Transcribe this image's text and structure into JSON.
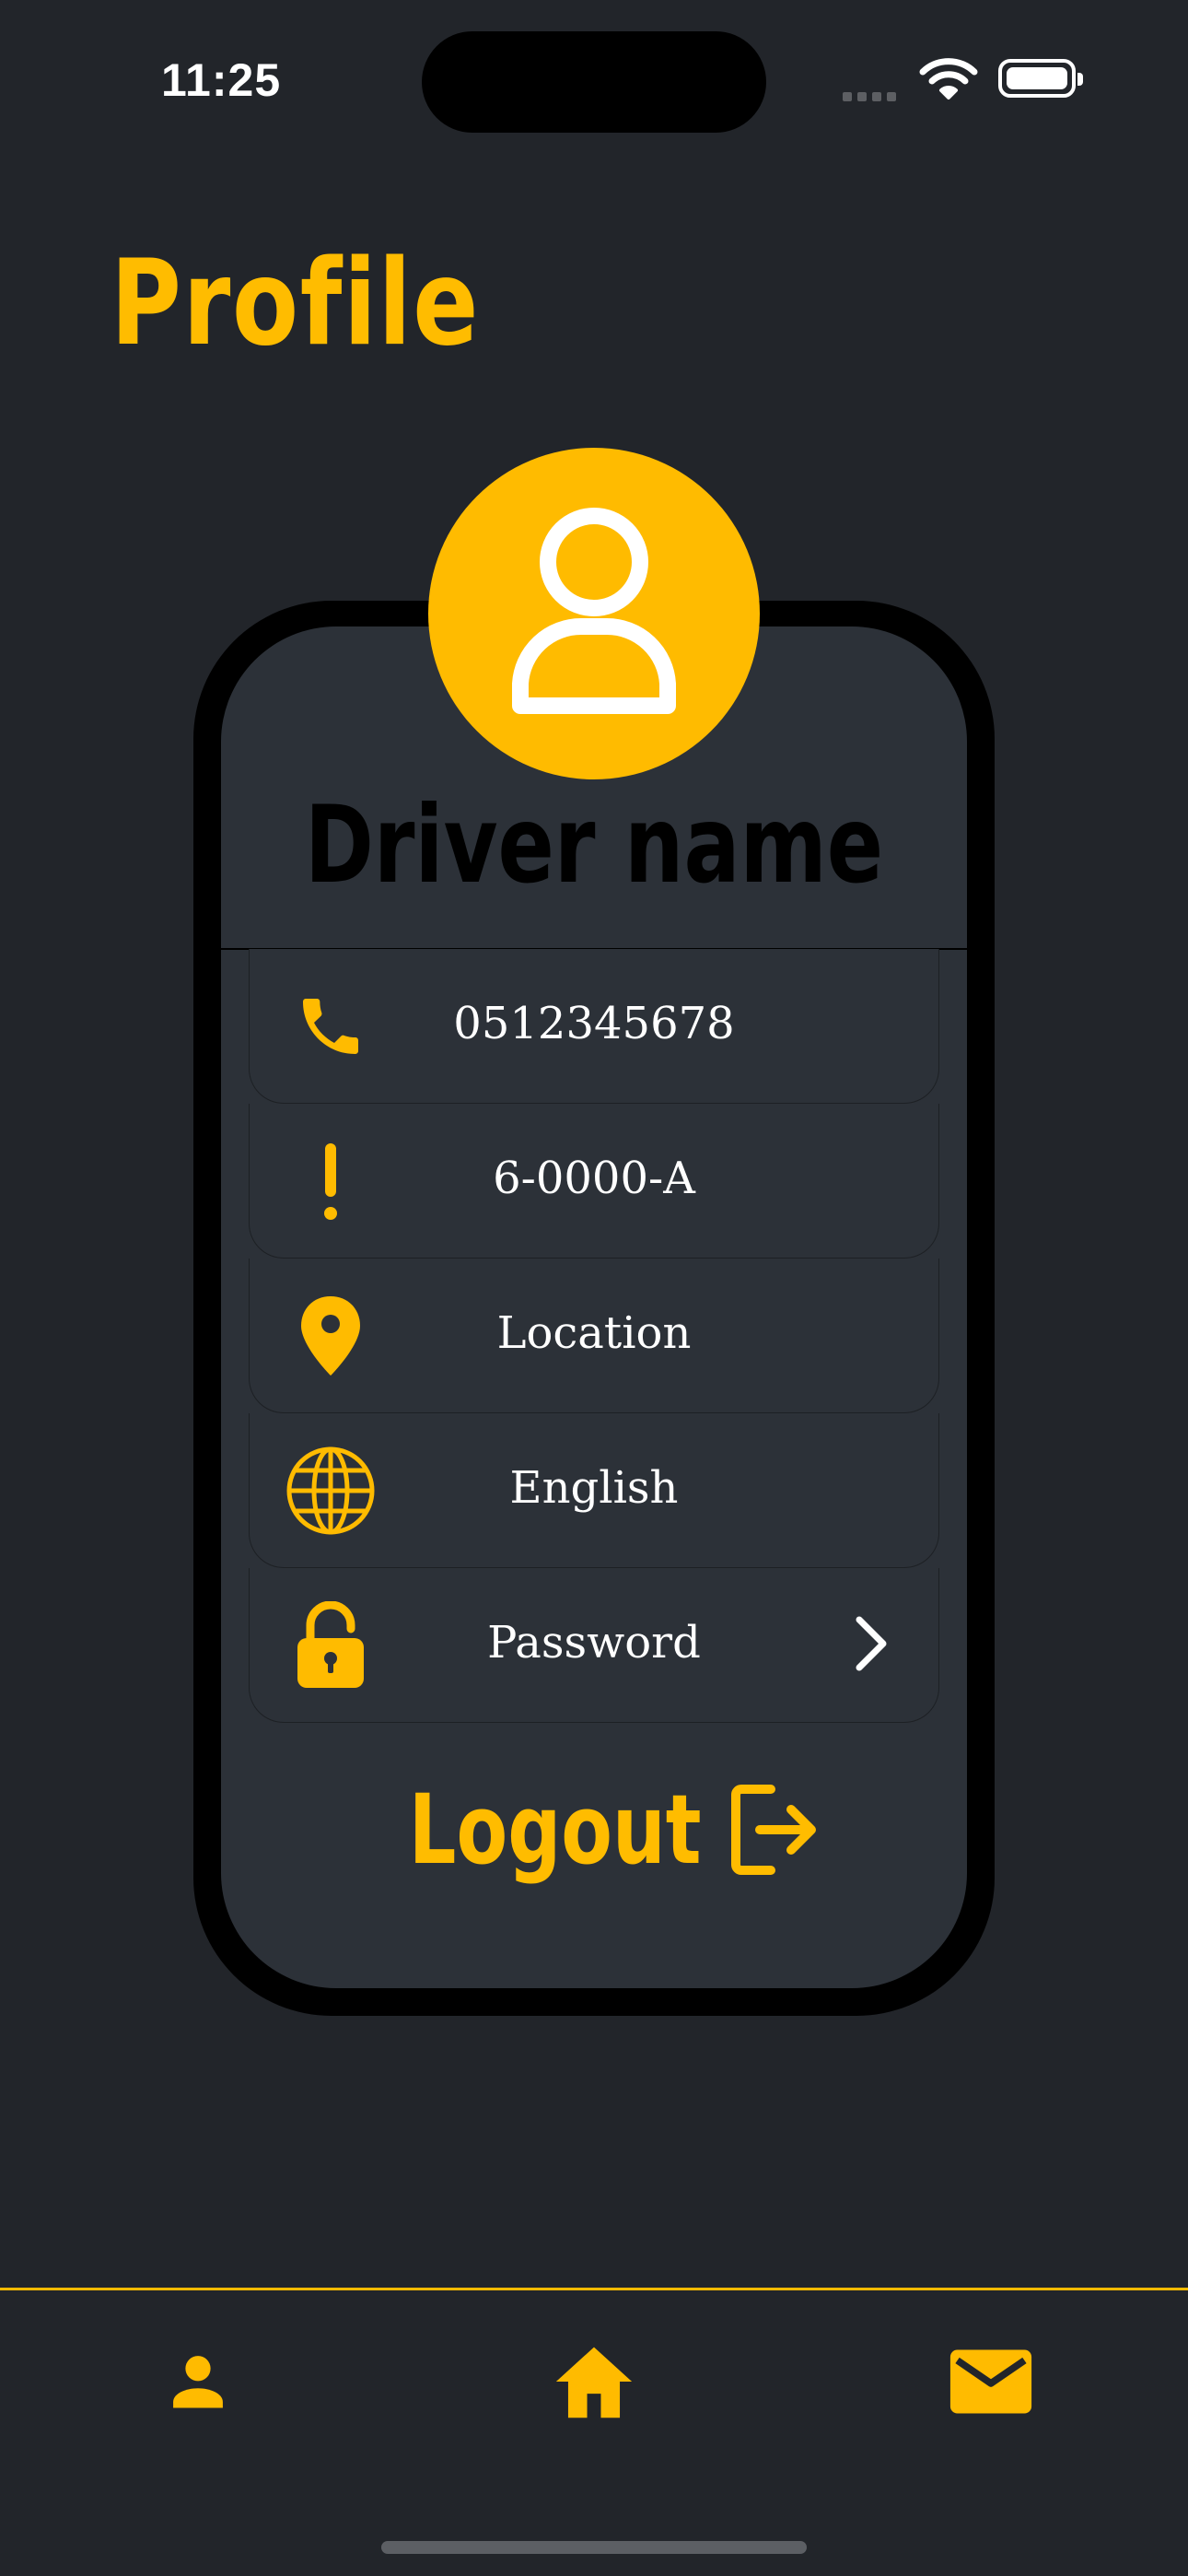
{
  "status_bar": {
    "time": "11:25"
  },
  "page": {
    "title": "Profile"
  },
  "profile": {
    "name": "Driver name",
    "avatar_icon": "person-outline-icon"
  },
  "rows": [
    {
      "icon": "phone-icon",
      "value": "0512345678"
    },
    {
      "icon": "exclamation-icon",
      "value": "6-0000-A"
    },
    {
      "icon": "location-pin-icon",
      "value": "Location"
    },
    {
      "icon": "globe-icon",
      "value": "English"
    },
    {
      "icon": "lock-open-icon",
      "value": "Password",
      "trailing_icon": "chevron-right-icon"
    }
  ],
  "logout": {
    "label": "Logout",
    "icon": "logout-icon"
  },
  "tab_bar": {
    "tabs": [
      {
        "icon": "person-icon"
      },
      {
        "icon": "home-icon"
      },
      {
        "icon": "mail-icon"
      }
    ]
  },
  "colors": {
    "background": "#22252a",
    "card": "#2c3138",
    "accent": "#ffbb00",
    "text": "#ffffff"
  }
}
